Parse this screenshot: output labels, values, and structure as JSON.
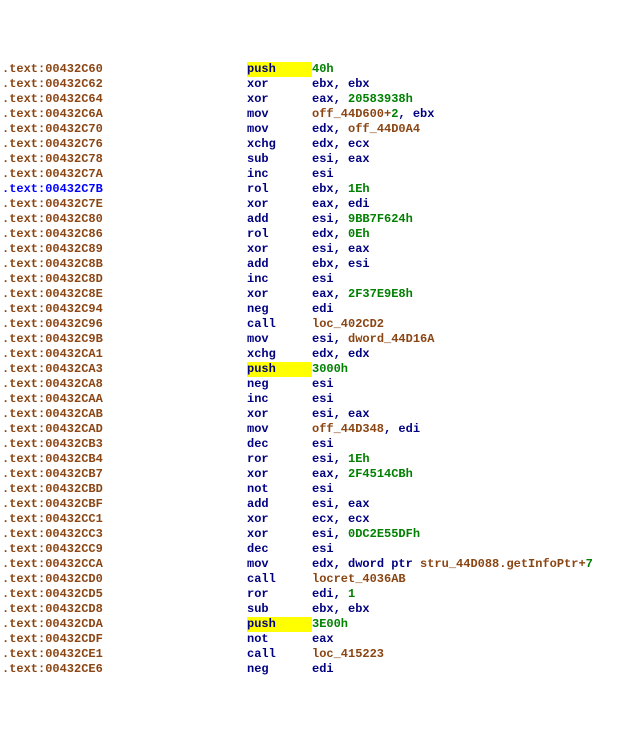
{
  "lines": [
    {
      "addr": ".text:00432C60",
      "addrClass": "segment-label",
      "mnem": "push",
      "hl": true,
      "ops": [
        {
          "t": "40h",
          "c": "num"
        }
      ]
    },
    {
      "addr": ".text:00432C62",
      "addrClass": "segment-label",
      "mnem": "xor",
      "ops": [
        {
          "t": "ebx",
          "c": "reg"
        },
        {
          "t": ", ",
          "c": "punct"
        },
        {
          "t": "ebx",
          "c": "reg"
        }
      ]
    },
    {
      "addr": ".text:00432C64",
      "addrClass": "segment-label",
      "mnem": "xor",
      "ops": [
        {
          "t": "eax",
          "c": "reg"
        },
        {
          "t": ", ",
          "c": "punct"
        },
        {
          "t": "20583938h",
          "c": "num"
        }
      ]
    },
    {
      "addr": ".text:00432C6A",
      "addrClass": "segment-label",
      "mnem": "mov",
      "ops": [
        {
          "t": "off_44D600",
          "c": "ref"
        },
        {
          "t": "+",
          "c": "ref"
        },
        {
          "t": "2",
          "c": "num"
        },
        {
          "t": ", ",
          "c": "punct"
        },
        {
          "t": "ebx",
          "c": "reg"
        }
      ]
    },
    {
      "addr": ".text:00432C70",
      "addrClass": "segment-label",
      "mnem": "mov",
      "ops": [
        {
          "t": "edx",
          "c": "reg"
        },
        {
          "t": ", ",
          "c": "punct"
        },
        {
          "t": "off_44D0A4",
          "c": "ref"
        }
      ]
    },
    {
      "addr": ".text:00432C76",
      "addrClass": "segment-label",
      "mnem": "xchg",
      "ops": [
        {
          "t": "edx",
          "c": "reg"
        },
        {
          "t": ", ",
          "c": "punct"
        },
        {
          "t": "ecx",
          "c": "reg"
        }
      ]
    },
    {
      "addr": ".text:00432C78",
      "addrClass": "segment-label",
      "mnem": "sub",
      "ops": [
        {
          "t": "esi",
          "c": "reg"
        },
        {
          "t": ", ",
          "c": "punct"
        },
        {
          "t": "eax",
          "c": "reg"
        }
      ]
    },
    {
      "addr": ".text:00432C7A",
      "addrClass": "segment-label",
      "mnem": "inc",
      "ops": [
        {
          "t": "esi",
          "c": "reg"
        }
      ]
    },
    {
      "addr": ".text:00432C7B",
      "addrClass": "segment-label-blue",
      "mnem": "rol",
      "ops": [
        {
          "t": "ebx",
          "c": "reg"
        },
        {
          "t": ", ",
          "c": "punct"
        },
        {
          "t": "1Eh",
          "c": "num"
        }
      ]
    },
    {
      "addr": ".text:00432C7E",
      "addrClass": "segment-label",
      "mnem": "xor",
      "ops": [
        {
          "t": "eax",
          "c": "reg"
        },
        {
          "t": ", ",
          "c": "punct"
        },
        {
          "t": "edi",
          "c": "reg"
        }
      ]
    },
    {
      "addr": ".text:00432C80",
      "addrClass": "segment-label",
      "mnem": "add",
      "ops": [
        {
          "t": "esi",
          "c": "reg"
        },
        {
          "t": ", ",
          "c": "punct"
        },
        {
          "t": "9BB7F624h",
          "c": "num"
        }
      ]
    },
    {
      "addr": ".text:00432C86",
      "addrClass": "segment-label",
      "mnem": "rol",
      "ops": [
        {
          "t": "edx",
          "c": "reg"
        },
        {
          "t": ", ",
          "c": "punct"
        },
        {
          "t": "0Eh",
          "c": "num"
        }
      ]
    },
    {
      "addr": ".text:00432C89",
      "addrClass": "segment-label",
      "mnem": "xor",
      "ops": [
        {
          "t": "esi",
          "c": "reg"
        },
        {
          "t": ", ",
          "c": "punct"
        },
        {
          "t": "eax",
          "c": "reg"
        }
      ]
    },
    {
      "addr": ".text:00432C8B",
      "addrClass": "segment-label",
      "mnem": "add",
      "ops": [
        {
          "t": "ebx",
          "c": "reg"
        },
        {
          "t": ", ",
          "c": "punct"
        },
        {
          "t": "esi",
          "c": "reg"
        }
      ]
    },
    {
      "addr": ".text:00432C8D",
      "addrClass": "segment-label",
      "mnem": "inc",
      "ops": [
        {
          "t": "esi",
          "c": "reg"
        }
      ]
    },
    {
      "addr": ".text:00432C8E",
      "addrClass": "segment-label",
      "mnem": "xor",
      "ops": [
        {
          "t": "eax",
          "c": "reg"
        },
        {
          "t": ", ",
          "c": "punct"
        },
        {
          "t": "2F37E9E8h",
          "c": "num"
        }
      ]
    },
    {
      "addr": ".text:00432C94",
      "addrClass": "segment-label",
      "mnem": "neg",
      "ops": [
        {
          "t": "edi",
          "c": "reg"
        }
      ]
    },
    {
      "addr": ".text:00432C96",
      "addrClass": "segment-label",
      "mnem": "call",
      "ops": [
        {
          "t": "loc_402CD2",
          "c": "ref"
        }
      ]
    },
    {
      "addr": ".text:00432C9B",
      "addrClass": "segment-label",
      "mnem": "mov",
      "ops": [
        {
          "t": "esi",
          "c": "reg"
        },
        {
          "t": ", ",
          "c": "punct"
        },
        {
          "t": "dword_44D16A",
          "c": "ref"
        }
      ]
    },
    {
      "addr": ".text:00432CA1",
      "addrClass": "segment-label",
      "mnem": "xchg",
      "ops": [
        {
          "t": "edx",
          "c": "reg"
        },
        {
          "t": ", ",
          "c": "punct"
        },
        {
          "t": "edx",
          "c": "reg"
        }
      ]
    },
    {
      "addr": ".text:00432CA3",
      "addrClass": "segment-label",
      "mnem": "push",
      "hl": true,
      "ops": [
        {
          "t": "3000h",
          "c": "num"
        }
      ]
    },
    {
      "addr": ".text:00432CA8",
      "addrClass": "segment-label",
      "mnem": "neg",
      "ops": [
        {
          "t": "esi",
          "c": "reg"
        }
      ]
    },
    {
      "addr": ".text:00432CAA",
      "addrClass": "segment-label",
      "mnem": "inc",
      "ops": [
        {
          "t": "esi",
          "c": "reg"
        }
      ]
    },
    {
      "addr": ".text:00432CAB",
      "addrClass": "segment-label",
      "mnem": "xor",
      "ops": [
        {
          "t": "esi",
          "c": "reg"
        },
        {
          "t": ", ",
          "c": "punct"
        },
        {
          "t": "eax",
          "c": "reg"
        }
      ]
    },
    {
      "addr": ".text:00432CAD",
      "addrClass": "segment-label",
      "mnem": "mov",
      "ops": [
        {
          "t": "off_44D348",
          "c": "ref"
        },
        {
          "t": ", ",
          "c": "punct"
        },
        {
          "t": "edi",
          "c": "reg"
        }
      ]
    },
    {
      "addr": ".text:00432CB3",
      "addrClass": "segment-label",
      "mnem": "dec",
      "ops": [
        {
          "t": "esi",
          "c": "reg"
        }
      ]
    },
    {
      "addr": ".text:00432CB4",
      "addrClass": "segment-label",
      "mnem": "ror",
      "ops": [
        {
          "t": "esi",
          "c": "reg"
        },
        {
          "t": ", ",
          "c": "punct"
        },
        {
          "t": "1Eh",
          "c": "num"
        }
      ]
    },
    {
      "addr": ".text:00432CB7",
      "addrClass": "segment-label",
      "mnem": "xor",
      "ops": [
        {
          "t": "eax",
          "c": "reg"
        },
        {
          "t": ", ",
          "c": "punct"
        },
        {
          "t": "2F4514CBh",
          "c": "num"
        }
      ]
    },
    {
      "addr": ".text:00432CBD",
      "addrClass": "segment-label",
      "mnem": "not",
      "ops": [
        {
          "t": "esi",
          "c": "reg"
        }
      ]
    },
    {
      "addr": ".text:00432CBF",
      "addrClass": "segment-label",
      "mnem": "add",
      "ops": [
        {
          "t": "esi",
          "c": "reg"
        },
        {
          "t": ", ",
          "c": "punct"
        },
        {
          "t": "eax",
          "c": "reg"
        }
      ]
    },
    {
      "addr": ".text:00432CC1",
      "addrClass": "segment-label",
      "mnem": "xor",
      "ops": [
        {
          "t": "ecx",
          "c": "reg"
        },
        {
          "t": ", ",
          "c": "punct"
        },
        {
          "t": "ecx",
          "c": "reg"
        }
      ]
    },
    {
      "addr": ".text:00432CC3",
      "addrClass": "segment-label",
      "mnem": "xor",
      "ops": [
        {
          "t": "esi",
          "c": "reg"
        },
        {
          "t": ", ",
          "c": "punct"
        },
        {
          "t": "0DC2E55DFh",
          "c": "num"
        }
      ]
    },
    {
      "addr": ".text:00432CC9",
      "addrClass": "segment-label",
      "mnem": "dec",
      "ops": [
        {
          "t": "esi",
          "c": "reg"
        }
      ]
    },
    {
      "addr": ".text:00432CCA",
      "addrClass": "segment-label",
      "mnem": "mov",
      "ops": [
        {
          "t": "edx",
          "c": "reg"
        },
        {
          "t": ", ",
          "c": "punct"
        },
        {
          "t": "dword ptr ",
          "c": "kw"
        },
        {
          "t": "stru_44D088.getInfoPtr",
          "c": "ref"
        },
        {
          "t": "+",
          "c": "ref"
        },
        {
          "t": "7",
          "c": "num"
        }
      ]
    },
    {
      "addr": ".text:00432CD0",
      "addrClass": "segment-label",
      "mnem": "call",
      "ops": [
        {
          "t": "locret_4036AB",
          "c": "ref"
        }
      ]
    },
    {
      "addr": ".text:00432CD5",
      "addrClass": "segment-label",
      "mnem": "ror",
      "ops": [
        {
          "t": "edi",
          "c": "reg"
        },
        {
          "t": ", ",
          "c": "punct"
        },
        {
          "t": "1",
          "c": "num"
        }
      ]
    },
    {
      "addr": ".text:00432CD8",
      "addrClass": "segment-label",
      "mnem": "sub",
      "ops": [
        {
          "t": "ebx",
          "c": "reg"
        },
        {
          "t": ", ",
          "c": "punct"
        },
        {
          "t": "ebx",
          "c": "reg"
        }
      ]
    },
    {
      "addr": ".text:00432CDA",
      "addrClass": "segment-label",
      "mnem": "push",
      "hl": true,
      "ops": [
        {
          "t": "3E00h",
          "c": "num"
        }
      ]
    },
    {
      "addr": ".text:00432CDF",
      "addrClass": "segment-label",
      "mnem": "not",
      "ops": [
        {
          "t": "eax",
          "c": "reg"
        }
      ]
    },
    {
      "addr": ".text:00432CE1",
      "addrClass": "segment-label",
      "mnem": "call",
      "ops": [
        {
          "t": "loc_415223",
          "c": "ref"
        }
      ]
    },
    {
      "addr": ".text:00432CE6",
      "addrClass": "segment-label",
      "mnem": "neg",
      "ops": [
        {
          "t": "edi",
          "c": "reg"
        }
      ]
    }
  ]
}
